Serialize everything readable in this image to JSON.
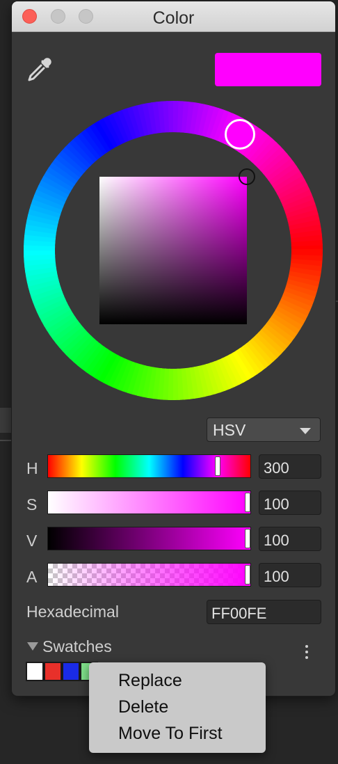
{
  "window": {
    "title": "Color"
  },
  "color": {
    "preview_hex": "#FF00FE",
    "hue_deg": 300,
    "saturation_pct": 100,
    "value_pct": 100,
    "alpha_pct": 100
  },
  "mode": {
    "selected": "HSV"
  },
  "sliders": [
    {
      "label": "H",
      "value": "300",
      "fraction": 0.8333
    },
    {
      "label": "S",
      "value": "100",
      "fraction": 1.0
    },
    {
      "label": "V",
      "value": "100",
      "fraction": 1.0
    },
    {
      "label": "A",
      "value": "100",
      "fraction": 1.0
    }
  ],
  "hex": {
    "label": "Hexadecimal",
    "value": "FF00FE"
  },
  "swatches": {
    "label": "Swatches",
    "colors": [
      "#FFFFFF",
      "#E8302A",
      "#1A2BE6",
      "#7FE08A"
    ]
  },
  "context_menu": {
    "items": [
      "Replace",
      "Delete",
      "Move To First"
    ]
  },
  "icons": {
    "eyedropper": "eyedropper-icon",
    "more": "more-options-icon",
    "collapse": "disclosure-triangle-icon"
  }
}
